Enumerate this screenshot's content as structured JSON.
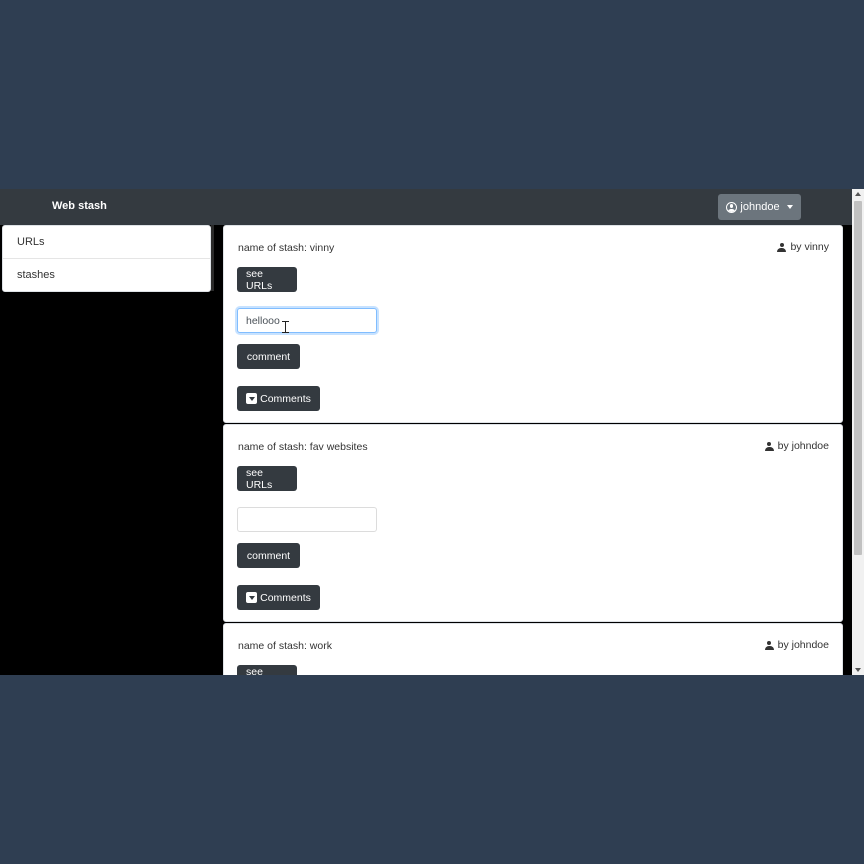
{
  "navbar": {
    "brand": "Web stash",
    "user_label": "johndoe"
  },
  "sidebar": {
    "items": [
      {
        "label": "URLs"
      },
      {
        "label": "stashes"
      }
    ]
  },
  "stashes": [
    {
      "title": "name of stash: vinny",
      "owner": "by vinny",
      "see_urls_label": "see URLs",
      "comment_value": "hellooo",
      "comment_label": "comment",
      "comments_label": "Comments"
    },
    {
      "title": "name of stash: fav websites",
      "owner": "by johndoe",
      "see_urls_label": "see URLs",
      "comment_value": "",
      "comment_label": "comment",
      "comments_label": "Comments"
    },
    {
      "title": "name of stash: work",
      "owner": "by johndoe",
      "see_urls_label": "see URLs"
    }
  ],
  "colors": {
    "backdrop": "#2f3e52",
    "navbar": "#343a40",
    "button_dark": "#343a40",
    "user_button": "#6c757d",
    "focus_border": "#80bdff"
  }
}
